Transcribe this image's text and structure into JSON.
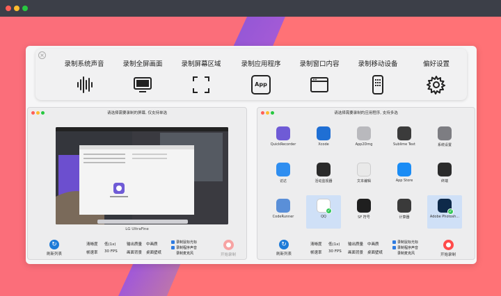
{
  "colors": {
    "background": "#fb6e7a",
    "accent_blue": "#1d7bd8",
    "record_red": "#ff4b4b"
  },
  "toolbar": {
    "close_glyph": "×",
    "items": [
      {
        "label": "录制系统声音",
        "icon": "waveform-icon"
      },
      {
        "label": "录制全屏画面",
        "icon": "monitor-icon"
      },
      {
        "label": "录制屏幕区域",
        "icon": "selection-frame-icon"
      },
      {
        "label": "录制应用程序",
        "icon": "app-icon",
        "icon_text": "App"
      },
      {
        "label": "录制窗口内容",
        "icon": "window-icon"
      },
      {
        "label": "录制移动设备",
        "icon": "phone-icon"
      },
      {
        "label": "偏好设置",
        "icon": "gear-icon"
      }
    ]
  },
  "screen_window": {
    "title": "请选择需要录制的屏幕, 仅支持单选",
    "display_name": "LG UltraFine",
    "refresh_label": "刷新列表",
    "options": {
      "quality_label": "清晰度",
      "quality_value": "低(1x)",
      "fps_label": "帧速率",
      "fps_value": "30 FPS",
      "output_label": "输出质量",
      "output_value": "中画质",
      "bg_label": "画面背景",
      "bg_value": "桌面壁纸"
    },
    "checks": [
      "录制鼠标光标",
      "录制程序声音",
      "录制麦克风"
    ],
    "record_label": "开始录制"
  },
  "app_window": {
    "title": "请选择需要录制的应用程序, 支持多选",
    "refresh_label": "刷新列表",
    "options": {
      "quality_label": "清晰度",
      "quality_value": "低(1x)",
      "fps_label": "帧速率",
      "fps_value": "30 FPS",
      "output_label": "输出质量",
      "output_value": "中画质",
      "bg_label": "画面背景",
      "bg_value": "桌面壁纸"
    },
    "checks": [
      "录制鼠标光标",
      "录制程序声音",
      "录制麦克风"
    ],
    "record_label": "开始录制",
    "apps": [
      {
        "name": "QuickRecorder",
        "color": "#6f5bd6",
        "selected": false
      },
      {
        "name": "Xcode",
        "color": "#1f6fd4",
        "selected": false
      },
      {
        "name": "App2Dmg",
        "color": "#b9b9bd",
        "selected": false
      },
      {
        "name": "Sublime Text",
        "color": "#3b3b3b",
        "selected": false
      },
      {
        "name": "系统设置",
        "color": "#7d7d82",
        "selected": false
      },
      {
        "name": "访达",
        "color": "#2f8ef0",
        "selected": false
      },
      {
        "name": "活动监视器",
        "color": "#2a2a2a",
        "selected": false
      },
      {
        "name": "文本编辑",
        "color": "#e9e9e9",
        "selected": false
      },
      {
        "name": "App Store",
        "color": "#1a8cf5",
        "selected": false
      },
      {
        "name": "终端",
        "color": "#2b2b2b",
        "selected": false
      },
      {
        "name": "CodeRunner",
        "color": "#5a8fd8",
        "selected": false
      },
      {
        "name": "QQ",
        "color": "#ffffff",
        "selected": true
      },
      {
        "name": "SF 符号",
        "color": "#1f1f1f",
        "selected": false
      },
      {
        "name": "计算器",
        "color": "#3a3a3a",
        "selected": false
      },
      {
        "name": "Adobe Photosh...",
        "color": "#0e2a4a",
        "selected": true
      }
    ]
  }
}
